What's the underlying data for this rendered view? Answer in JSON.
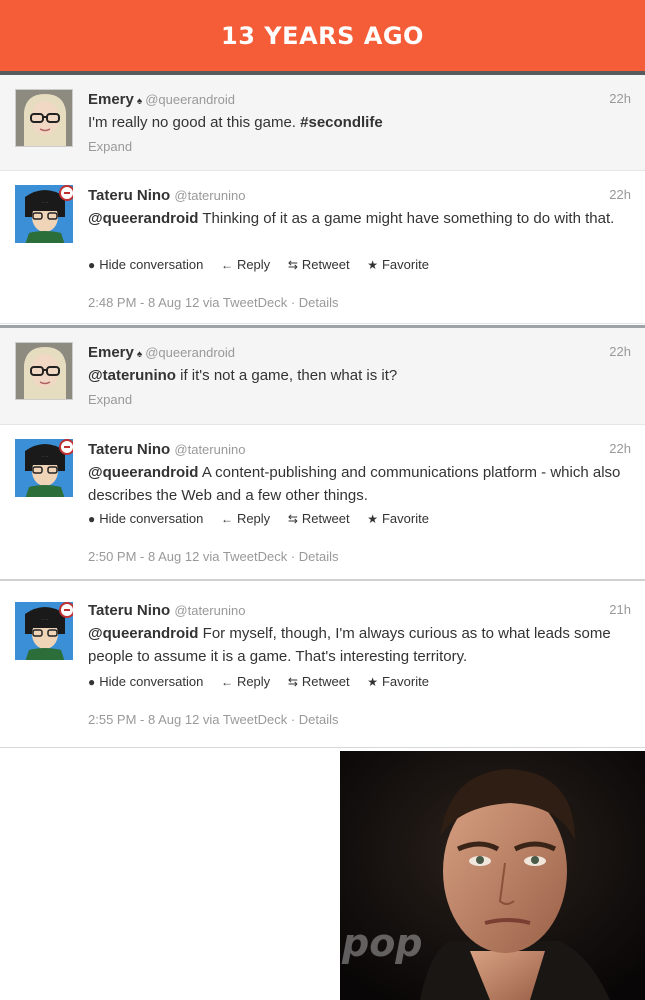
{
  "banner": {
    "title": "13 YEARS AGO"
  },
  "tweets": [
    {
      "name": "Emery",
      "badge": "♠",
      "handle": "@queerandroid",
      "time": "22h",
      "mention": "",
      "text": "I'm really no good at this game. ",
      "hashtag": "#secondlife",
      "expand": "Expand"
    },
    {
      "name": "Tateru Nino",
      "handle": "@taterunino",
      "time": "22h",
      "mention": "@queerandroid",
      "text": " Thinking of it as a game might have something to do with that.",
      "actions": {
        "hide": "Hide conversation",
        "reply": "Reply",
        "retweet": "Retweet",
        "favorite": "Favorite"
      },
      "meta": "2:48 PM - 8 Aug 12 via TweetDeck · Details"
    },
    {
      "name": "Emery",
      "badge": "♠",
      "handle": "@queerandroid",
      "time": "22h",
      "mention": "@taterunino",
      "text": " if it's not a game, then what is it?",
      "expand": "Expand"
    },
    {
      "name": "Tateru Nino",
      "handle": "@taterunino",
      "time": "22h",
      "mention": "@queerandroid",
      "text": " A content-publishing and communications platform - which also describes the Web and a few other things.",
      "actions": {
        "hide": "Hide conversation",
        "reply": "Reply",
        "retweet": "Retweet",
        "favorite": "Favorite"
      },
      "meta": "2:50 PM - 8 Aug 12 via TweetDeck · Details"
    },
    {
      "name": "Tateru Nino",
      "handle": "@taterunino",
      "time": "21h",
      "mention": "@queerandroid",
      "text": " For myself, though, I'm always curious as to what leads some people to assume it is a game. That's interesting territory.",
      "actions": {
        "hide": "Hide conversation",
        "reply": "Reply",
        "retweet": "Retweet",
        "favorite": "Favorite"
      },
      "meta": "2:55 PM - 8 Aug 12 via TweetDeck · Details"
    }
  ],
  "icons": {
    "hide": "speech-bubble-icon",
    "reply": "reply-arrow-icon",
    "retweet": "retweet-icon",
    "favorite": "star-icon"
  },
  "colors": {
    "banner": "#f45d37",
    "text": "#333333",
    "muted": "#999999"
  },
  "photo": {
    "watermark": "pop"
  }
}
